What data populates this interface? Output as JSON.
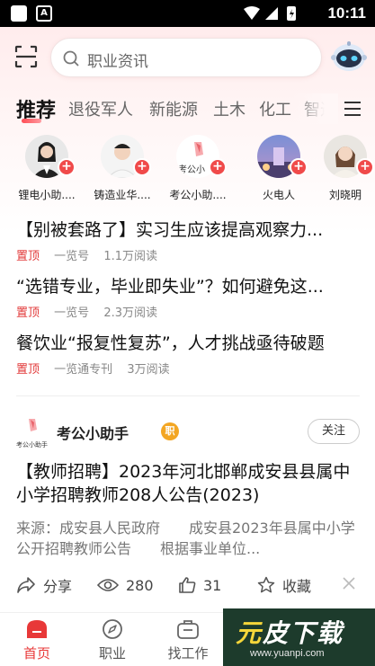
{
  "status_bar": {
    "time": "10:11"
  },
  "header": {
    "search_placeholder": "职业资讯"
  },
  "tabs": [
    {
      "label": "推荐",
      "active": true
    },
    {
      "label": "退役军人"
    },
    {
      "label": "新能源"
    },
    {
      "label": "土木"
    },
    {
      "label": "化工"
    },
    {
      "label": "智造"
    }
  ],
  "accounts": [
    {
      "name": "锂电小助...."
    },
    {
      "name": "铸造业华...."
    },
    {
      "name": "考公小助...."
    },
    {
      "name": "火电人"
    },
    {
      "name": "刘晓明"
    }
  ],
  "account_logo_text": "考公小",
  "pinned": [
    {
      "title": "【别被套路了】实习生应该提高观察力...",
      "tag": "置顶",
      "source": "一览号",
      "reads": "1.1万阅读"
    },
    {
      "title": "“选错专业，毕业即失业”？如何避免这...",
      "tag": "置顶",
      "source": "一览号",
      "reads": "2.3万阅读"
    },
    {
      "title": "餐饮业“报复性复苏”，人才挑战亟待破题",
      "tag": "置顶",
      "source": "一览通专刊",
      "reads": "3万阅读"
    }
  ],
  "article": {
    "author": "考公小助手",
    "logo_text": "考公小助手",
    "badge": "职",
    "follow_label": "关注",
    "title": "【教师招聘】2023年河北邯郸成安县县属中小学招聘教师208人公告(2023)",
    "excerpt": "来源：成安县人民政府　　成安县2023年县属中小学公开招聘教师公告　　根据事业单位...",
    "share_label": "分享",
    "views": "280",
    "likes": "31",
    "collect_label": "收藏"
  },
  "bottom_nav": [
    {
      "label": "首页",
      "active": true
    },
    {
      "label": "职业"
    },
    {
      "label": "找工作"
    }
  ],
  "watermark": {
    "text_a": "元",
    "text_b": "皮下载",
    "url": "www.yuanpi.com"
  },
  "colors": {
    "accent": "#e83838",
    "tag_red": "#e23a3a",
    "badge_gold": "#f3a623"
  }
}
